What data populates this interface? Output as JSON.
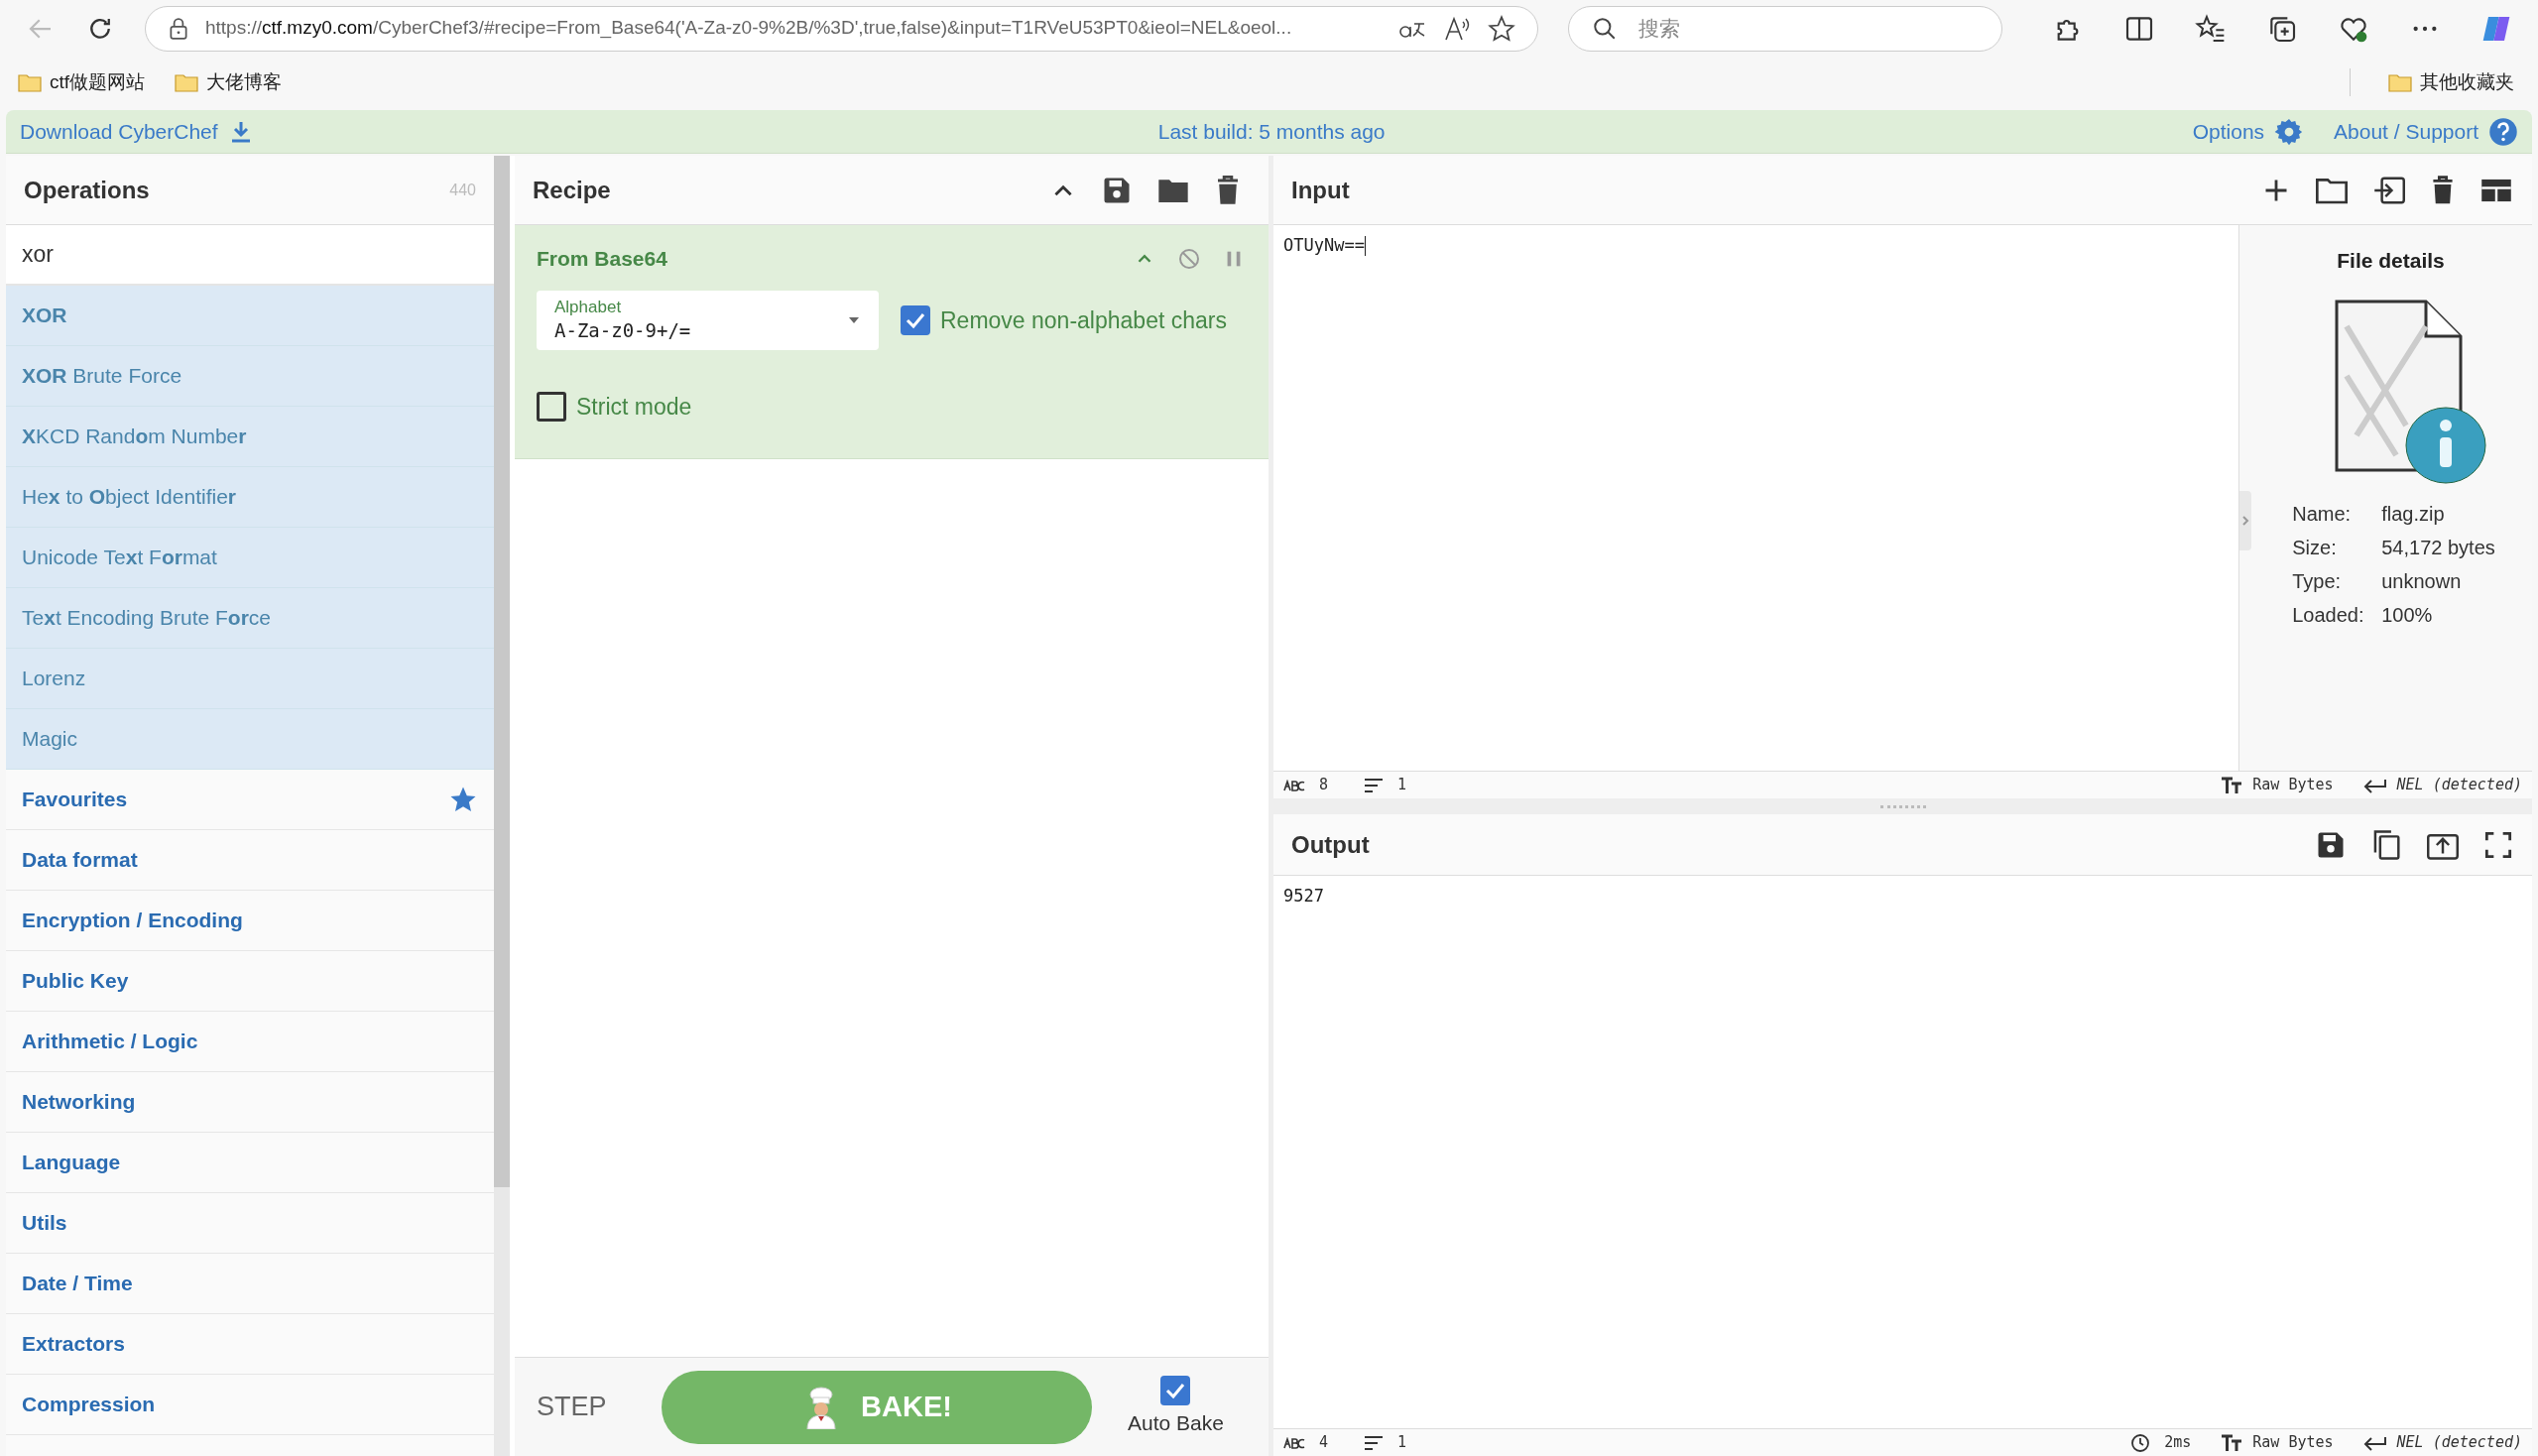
{
  "browser": {
    "url_prefix": "https://",
    "url_host": "ctf.mzy0.com",
    "url_path": "/CyberChef3/#recipe=From_Base64('A-Za-z0-9%2B/%3D',true,false)&input=T1RVeU53PT0&ieol=NEL&oeol...",
    "search_placeholder": "搜索",
    "bookmarks": [
      "ctf做题网站",
      "大佬博客"
    ],
    "other_bookmarks": "其他收藏夹"
  },
  "banner": {
    "download": "Download CyberChef",
    "build": "Last build: 5 months ago",
    "options": "Options",
    "about": "About / Support"
  },
  "operations": {
    "title": "Operations",
    "count": "440",
    "search": "xor",
    "results": [
      "**XOR**",
      "**XOR** Brute Force",
      "**X**KCD Rand**o**m Numbe**r**",
      "He**x** to **O**bject Identifie**r**",
      "Unicode Te**x**t F**or**mat",
      "Te**x**t Encoding Brute F**or**ce",
      "Lorenz",
      "Magic"
    ],
    "categories": [
      {
        "label": "Favourites",
        "starred": true
      },
      {
        "label": "Data format",
        "starred": false
      },
      {
        "label": "Encryption / Encoding",
        "starred": false
      },
      {
        "label": "Public Key",
        "starred": false
      },
      {
        "label": "Arithmetic / Logic",
        "starred": false
      },
      {
        "label": "Networking",
        "starred": false
      },
      {
        "label": "Language",
        "starred": false
      },
      {
        "label": "Utils",
        "starred": false
      },
      {
        "label": "Date / Time",
        "starred": false
      },
      {
        "label": "Extractors",
        "starred": false
      },
      {
        "label": "Compression",
        "starred": false
      }
    ]
  },
  "recipe": {
    "title": "Recipe",
    "ops": [
      {
        "name": "From Base64",
        "args": [
          {
            "kind": "dropdown",
            "label": "Alphabet",
            "value": "A-Za-z0-9+/="
          },
          {
            "kind": "checkbox",
            "label": "Remove non-alphabet chars",
            "checked": true
          },
          {
            "kind": "checkbox",
            "label": "Strict mode",
            "checked": false
          }
        ]
      }
    ]
  },
  "controls": {
    "step": "STEP",
    "bake": "BAKE!",
    "auto_bake": {
      "label": "Auto Bake",
      "checked": true
    }
  },
  "input": {
    "title": "Input",
    "text": "OTUyNw==",
    "status": {
      "length": "8",
      "lines": "1",
      "encoding": "Raw Bytes",
      "eol": "NEL (detected)"
    },
    "file": {
      "title": "File details",
      "rows": [
        {
          "label": "Name:",
          "value": "flag.zip"
        },
        {
          "label": "Size:",
          "value": "54,172 bytes"
        },
        {
          "label": "Type:",
          "value": "unknown"
        },
        {
          "label": "Loaded:",
          "value": "100%"
        }
      ]
    }
  },
  "output": {
    "title": "Output",
    "text": "9527",
    "status": {
      "length": "4",
      "lines": "1",
      "time": "2ms",
      "encoding": "Raw Bytes",
      "eol": "NEL (detected)"
    }
  }
}
